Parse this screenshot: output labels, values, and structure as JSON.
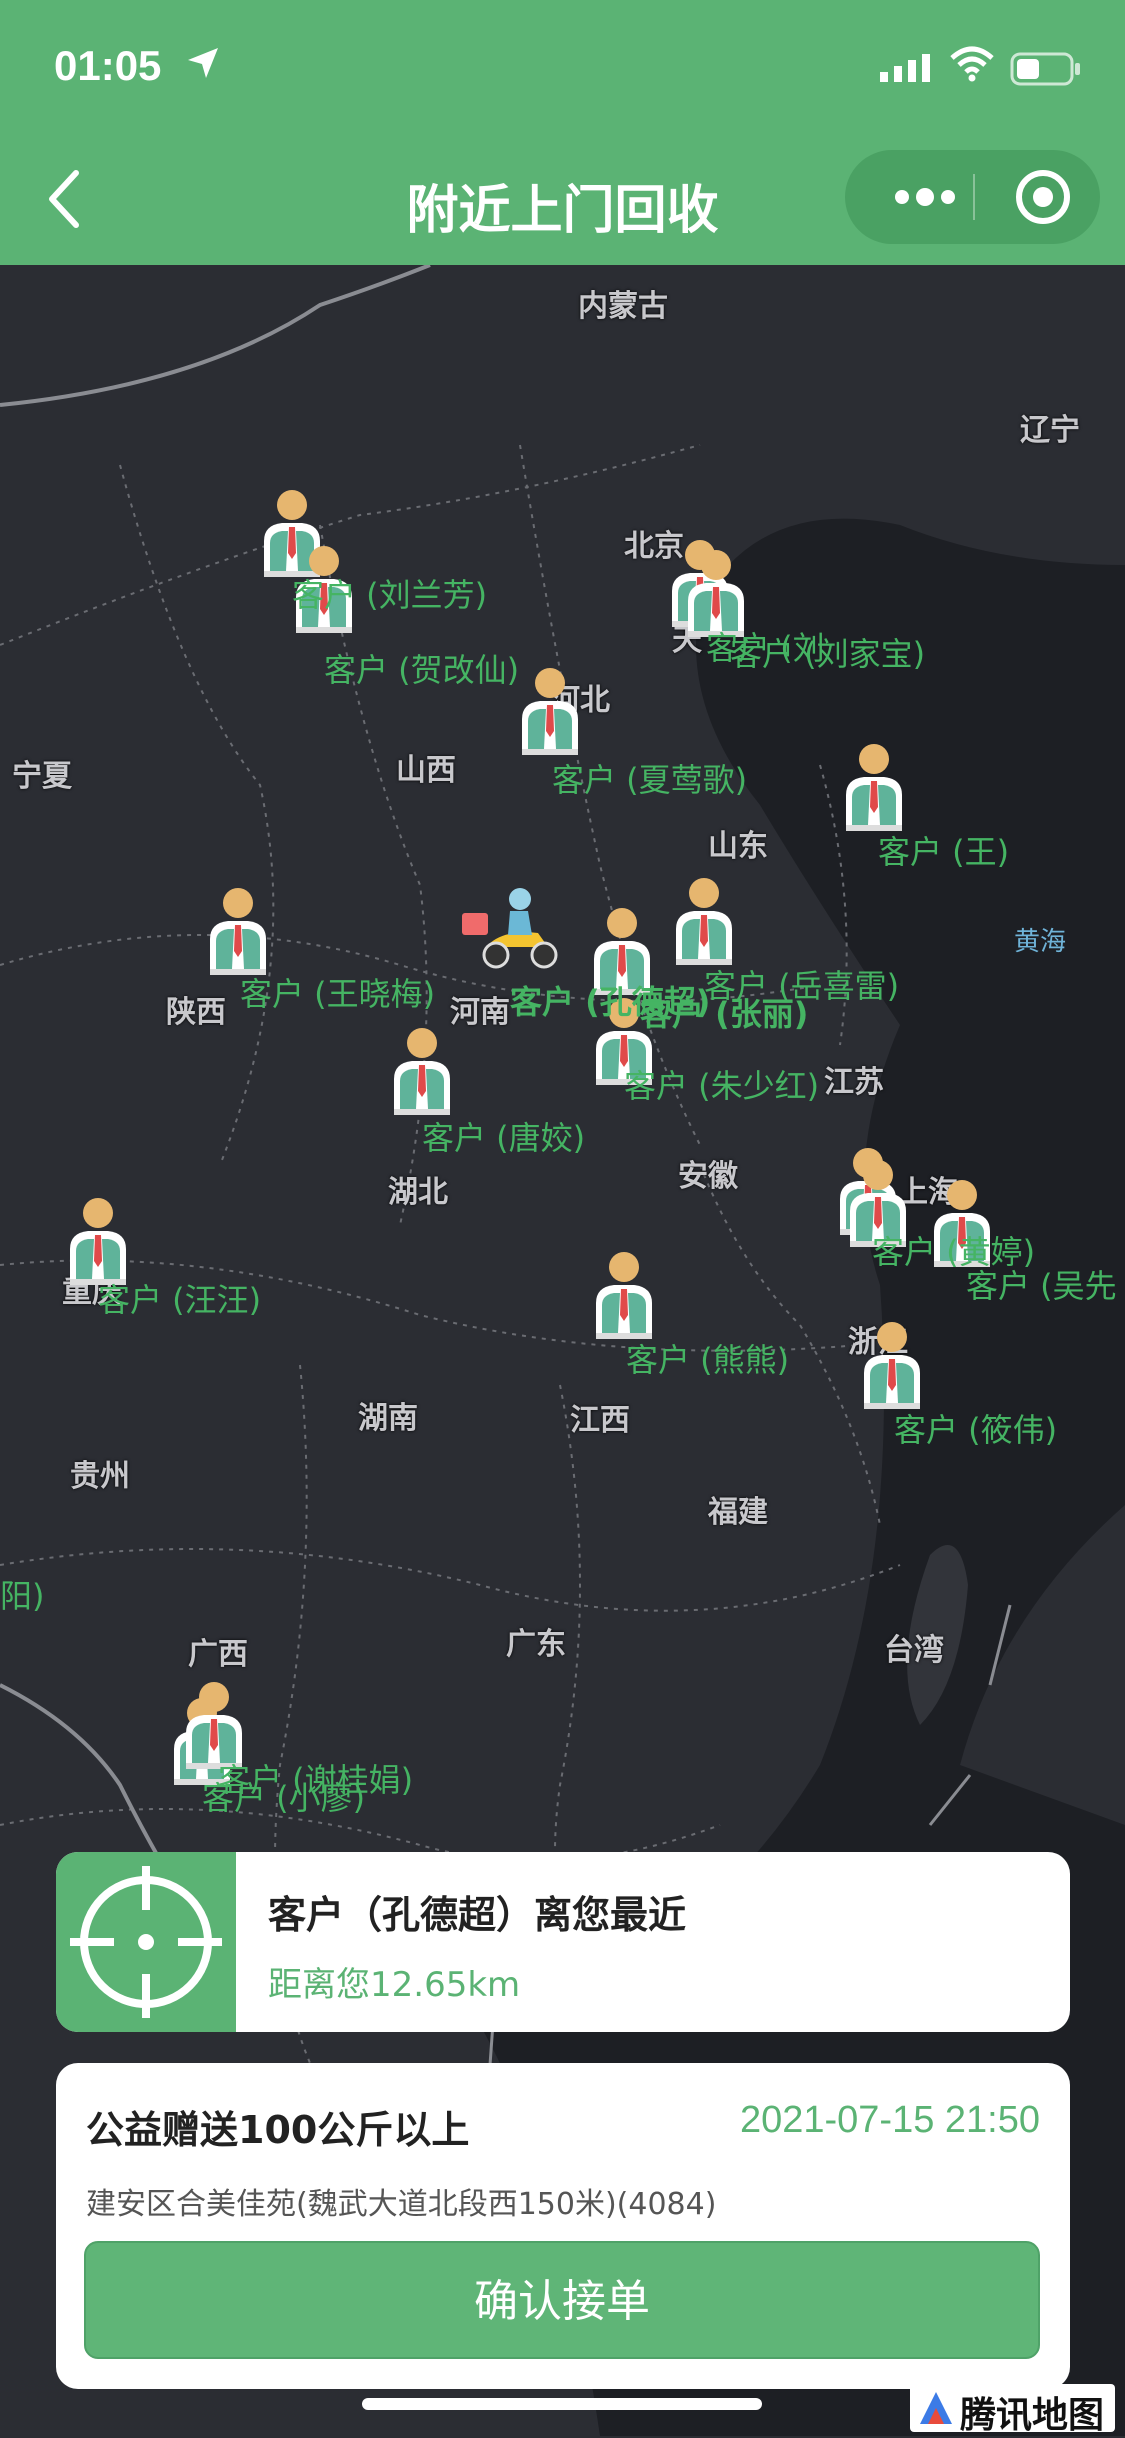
{
  "status_bar": {
    "time": "01:05"
  },
  "header": {
    "title": "附近上门回收"
  },
  "colors": {
    "brand": "#5bb374",
    "map_bg": "#2b2d33",
    "label_green": "#45b463"
  },
  "map": {
    "regions": [
      "内蒙古",
      "辽宁",
      "北京",
      "天",
      "河北",
      "宁夏",
      "山西",
      "山东",
      "黄海",
      "陕西",
      "河南",
      "江苏",
      "安徽",
      "湖北",
      "上海",
      "重庆",
      "浙江",
      "湖南",
      "江西",
      "贵州",
      "福建",
      "广西",
      "广东",
      "台湾",
      "阳)"
    ],
    "customers": [
      "客户 (刘兰芳)",
      "客户 (贺改仙)",
      "客户 (刘家宝)",
      "客户 (刘",
      "客户 (夏莺歌)",
      "客户 (王)",
      "客户 (王晓梅)",
      "客户 (岳喜雷)",
      "客户 (张丽)",
      "客户 (孔德超)",
      "客户 (朱少红)",
      "客户 (唐姣)",
      "客户 (汪汪)",
      "客户 (熊熊)",
      "客户 (黄婷)",
      "客户 (吴先",
      "客户 (筱伟)",
      "客户 (谢桂娟)",
      "客户 (小廖)"
    ]
  },
  "nearest": {
    "title": "客户（孔德超）离您最近",
    "distance": "距离您12.65km"
  },
  "order": {
    "title": "公益赠送100公斤以上",
    "time": "2021-07-15 21:50",
    "address": "建安区合美佳苑(魏武大道北段西150米)(4084)",
    "confirm_label": "确认接单"
  },
  "map_logo": "腾讯地图"
}
